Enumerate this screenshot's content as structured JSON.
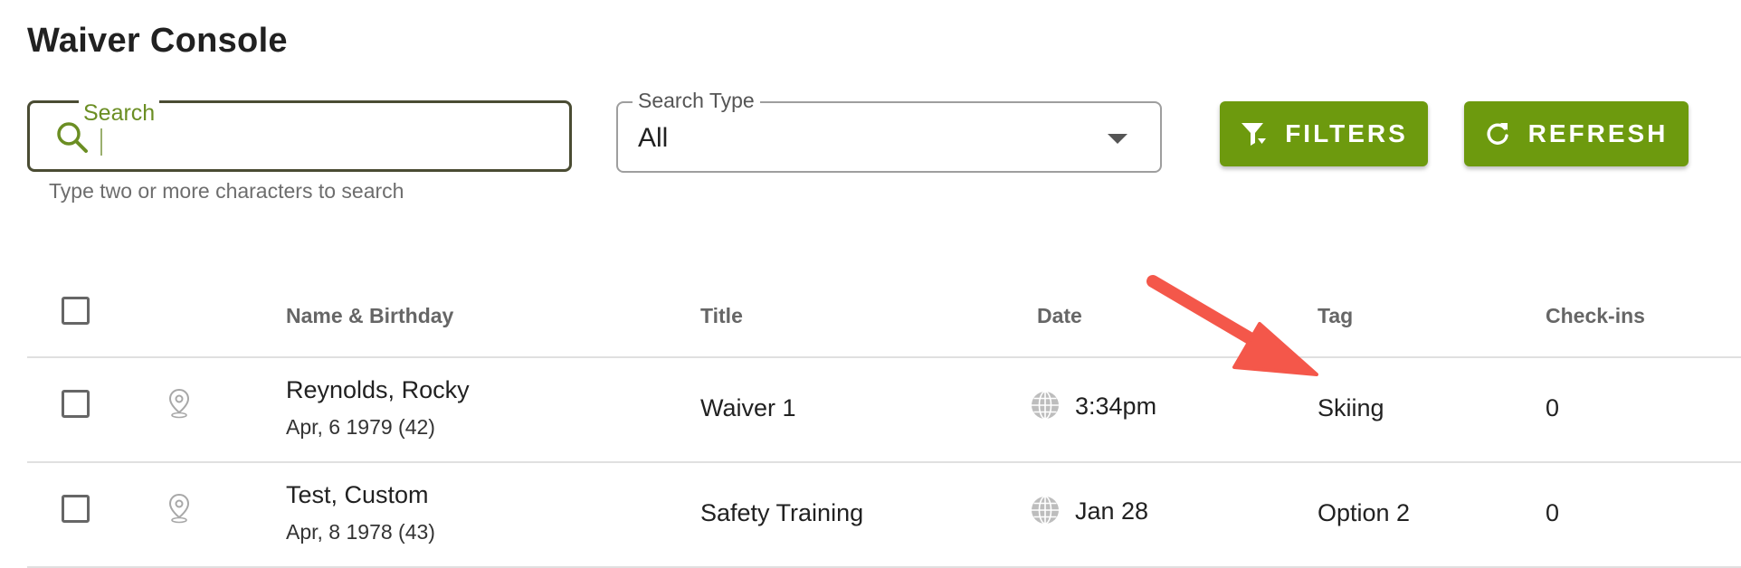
{
  "page": {
    "title": "Waiver Console"
  },
  "search": {
    "label": "Search",
    "value": "",
    "placeholder": "",
    "helper": "Type two or more characters to search"
  },
  "search_type": {
    "label": "Search Type",
    "value": "All"
  },
  "buttons": {
    "filters": "FILTERS",
    "refresh": "REFRESH"
  },
  "table": {
    "headers": {
      "name": "Name & Birthday",
      "title": "Title",
      "date": "Date",
      "tag": "Tag",
      "checkins": "Check-ins"
    },
    "rows": [
      {
        "name": "Reynolds, Rocky",
        "birthday": "Apr, 6 1979 (42)",
        "title": "Waiver 1",
        "date": "3:34pm",
        "tag": "Skiing",
        "checkins": "0"
      },
      {
        "name": "Test, Custom",
        "birthday": "Apr, 8 1978 (43)",
        "title": "Safety Training",
        "date": "Jan 28",
        "tag": "Option 2",
        "checkins": "0"
      }
    ]
  },
  "icons": {
    "search": "search-icon",
    "filter": "filter-icon",
    "refresh": "refresh-icon",
    "location": "location-pin-icon",
    "globe": "globe-icon",
    "dropdown": "chevron-down-icon"
  },
  "colors": {
    "accent": "#6d9a0e",
    "search_border": "#4a4c33",
    "search_label": "#6b8e23",
    "annotation_arrow": "#f4574a"
  }
}
